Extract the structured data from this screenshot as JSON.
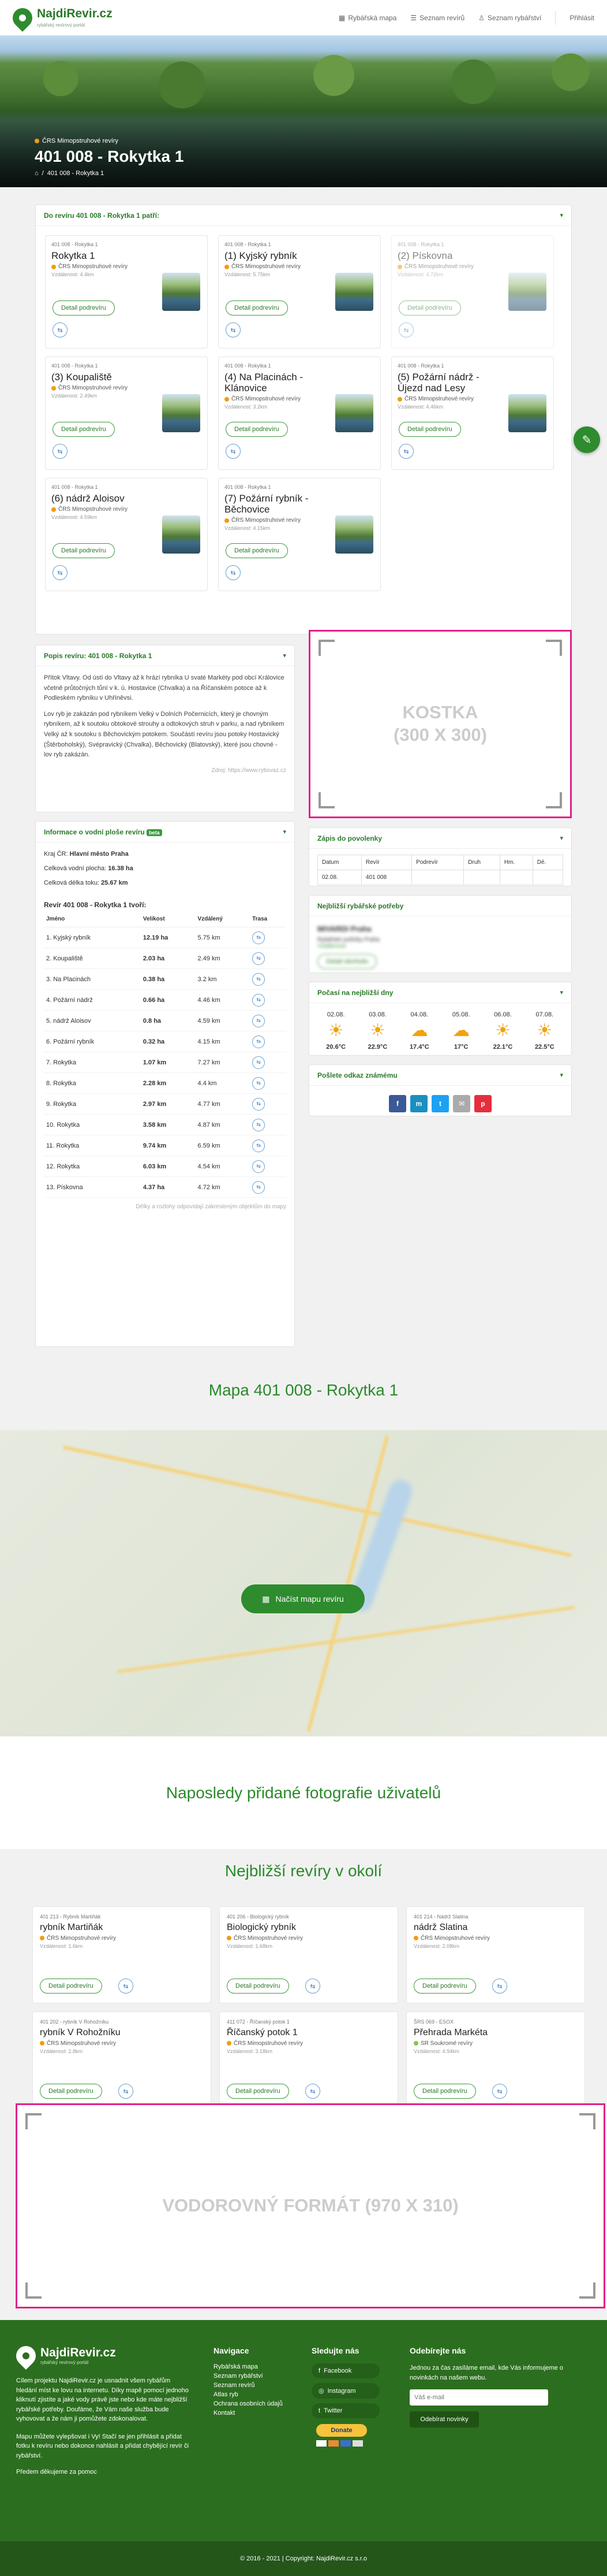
{
  "header": {
    "logo_name": "NajdiRevir.cz",
    "logo_tagline": "rybářský revírový portál",
    "nav": [
      {
        "label": "Rybářská mapa",
        "icon": "map-icon"
      },
      {
        "label": "Seznam revírů",
        "icon": "list-icon"
      },
      {
        "label": "Seznam rybářství",
        "icon": "person-icon"
      },
      {
        "label": "Přihlásit",
        "icon": ""
      }
    ]
  },
  "hero": {
    "label": "ČRS Mimopstruhové revíry",
    "title": "401 008 - Rokytka 1",
    "breadcrumb": "401 008 - Rokytka 1"
  },
  "belongs": {
    "title": "Do revíru 401 008 - Rokytka 1 patří:",
    "detail": "Detail podrevíru",
    "items": [
      {
        "cat": "401 008 - Rokytka 1",
        "name": "Rokytka 1",
        "org": "ČRS Mimopstruhové revíry",
        "dist": "Vzdálenost: 4.4km",
        "faded": false
      },
      {
        "cat": "401 008 - Rokytka 1",
        "name": "(1) Kyjský rybník",
        "org": "ČRS Mimopstruhové revíry",
        "dist": "Vzdálenost: 5.75km",
        "faded": false
      },
      {
        "cat": "401 008 - Rokytka 1",
        "name": "(2) Pískovna",
        "org": "ČRS Mimopstruhové revíry",
        "dist": "Vzdálenost: 4.72km",
        "faded": true
      },
      {
        "cat": "401 008 - Rokytka 1",
        "name": "(3) Koupaliště",
        "org": "ČRS Mimopstruhové revíry",
        "dist": "Vzdálenost: 2.49km",
        "faded": false
      },
      {
        "cat": "401 008 - Rokytka 1",
        "name": "(4) Na Placinách - Klánovice",
        "org": "ČRS Mimopstruhové revíry",
        "dist": "Vzdálenost: 3.2km",
        "faded": false
      },
      {
        "cat": "401 008 - Rokytka 1",
        "name": "(5) Požární nádrž - Újezd nad Lesy",
        "org": "ČRS Mimopstruhové revíry",
        "dist": "Vzdálenost: 4.46km",
        "faded": false
      },
      {
        "cat": "401 008 - Rokytka 1",
        "name": "(6) nádrž Aloisov",
        "org": "ČRS Mimopstruhové revíry",
        "dist": "Vzdálenost: 4.59km",
        "faded": false
      },
      {
        "cat": "401 008 - Rokytka 1",
        "name": "(7) Požární rybník - Běchovice",
        "org": "ČRS Mimopstruhové revíry",
        "dist": "Vzdálenost: 4.15km",
        "faded": false
      }
    ]
  },
  "description": {
    "title": "Popis revíru: 401 008 - Rokytka 1",
    "p1": "Přítok Vltavy. Od ústí do Vltavy až k hrází rybníka U svaté Markéty pod obcí Královice včetně průtočných tůní v k. ú. Hostavice (Chvalka) a na Říčanském potoce až k Podleském rybníku v Uhříněvsi.",
    "p2": "Lov ryb je zakázán pod rybníkem Velký v Dolních Počernicích, který je chovným rybníkem, až k soutoku obtokové strouhy a odtokových struh v parku, a nad rybníkem Velký až k soutoku s Běchovickým potokem. Součástí revíru jsou potoky Hostavický (Štěrbohol­ský), Svépravický (Chvalka), Běchovický (Blatovský), které jsou chovné - lov ryb zakázán.",
    "source": "Zdroj: https://www.rybsvaz.cz"
  },
  "ad_square": {
    "text": "KOSTKA\n(300 X 300)"
  },
  "water_info": {
    "title": "Informace o vodní ploše revíru",
    "badge": "beta",
    "kraj_label": "Kraj ČR:",
    "kraj": "Hlavní město Praha",
    "area_label": "Celková vodní plocha:",
    "area": "16.38 ha",
    "length_label": "Celková délka toku:",
    "length": "25.67 km",
    "consists": "Revír 401 008 - Rokytka 1 tvoří:",
    "columns": [
      "Jméno",
      "Velikost",
      "Vzdálený",
      "Trasa"
    ],
    "rows": [
      [
        "1. Kyjský rybník",
        "12.19 ha",
        "5.75 km"
      ],
      [
        "2. Koupaliště",
        "2.03 ha",
        "2.49 km"
      ],
      [
        "3. Na Placinách",
        "0.38 ha",
        "3.2 km"
      ],
      [
        "4. Požární nádrž",
        "0.66 ha",
        "4.46 km"
      ],
      [
        "5. nádrž Aloisov",
        "0.8 ha",
        "4.59 km"
      ],
      [
        "6. Požární rybník",
        "0.32 ha",
        "4.15 km"
      ],
      [
        "7. Rokytka",
        "1.07 km",
        "7.27 km"
      ],
      [
        "8. Rokytka",
        "2.28 km",
        "4.4 km"
      ],
      [
        "9. Rokytka",
        "2.97 km",
        "4.77 km"
      ],
      [
        "10. Rokytka",
        "3.58 km",
        "4.87 km"
      ],
      [
        "11. Rokytka",
        "9.74 km",
        "6.59 km"
      ],
      [
        "12. Rokytka",
        "6.03 km",
        "4.54 km"
      ],
      [
        "13. Pískovna",
        "4.37 ha",
        "4.72 km"
      ]
    ],
    "note": "Délky a rozlohy odpovídají zakresleným objektům do mapy"
  },
  "catch": {
    "title": "Zápis do povolenky",
    "columns": [
      "Datum",
      "Revír",
      "Podrevír",
      "Druh",
      "Hm.",
      "Dé."
    ],
    "row": [
      "02.08.",
      "401 008",
      "",
      "",
      "",
      ""
    ]
  },
  "shop": {
    "title": "Nejbližší rybářské potřeby",
    "name": "MIVARDI Praha",
    "line1": "Rybářské potřeby Praha",
    "line2": "Vzdálenost",
    "btn": "Detail obchodu"
  },
  "weather": {
    "title": "Počasí na nejbližší dny",
    "days": [
      {
        "d": "02.08.",
        "t": "20.6°C",
        "i": "☀"
      },
      {
        "d": "03.08.",
        "t": "22.9°C",
        "i": "☀"
      },
      {
        "d": "04.08.",
        "t": "17.4°C",
        "i": "☁"
      },
      {
        "d": "05.08.",
        "t": "17°C",
        "i": "☁"
      },
      {
        "d": "06.08.",
        "t": "22.1°C",
        "i": "☀"
      },
      {
        "d": "07.08.",
        "t": "22.5°C",
        "i": "☀"
      }
    ]
  },
  "share": {
    "title": "Pošlete odkaz známému"
  },
  "map_section": {
    "title": "Mapa 401 008 - Rokytka 1",
    "load": "Načíst mapu revíru"
  },
  "photos": {
    "title": "Naposledy přidané fotografie uživatelů"
  },
  "nearest": {
    "title": "Nejbližší revíry v okolí",
    "detail": "Detail podrevíru",
    "items": [
      {
        "cat": "401 213 - Rybník Martiňák",
        "name": "rybník Martiňák",
        "org": "ČRS Mimopstruhové revíry",
        "dist": "Vzdálenost: 1.6km",
        "color": "#f39c12"
      },
      {
        "cat": "401 206 - Biologický rybník",
        "name": "Biologický rybník",
        "org": "ČRS Mimopstruhové revíry",
        "dist": "Vzdálenost: 1.68km",
        "color": "#f39c12"
      },
      {
        "cat": "401 214 - Nádrž Slatina",
        "name": "nádrž Slatina",
        "org": "ČRS Mimopstruhové revíry",
        "dist": "Vzdálenost: 2.08km",
        "color": "#f39c12"
      },
      {
        "cat": "401 202 - rybník V Rohožníku",
        "name": "rybník V Rohožníku",
        "org": "ČRS Mimopstruhové revíry",
        "dist": "Vzdálenost: 2.8km",
        "color": "#f39c12"
      },
      {
        "cat": "411 072 - Říčanský potok 1",
        "name": "Říčanský potok 1",
        "org": "ČRS Mimopstruhové revíry",
        "dist": "Vzdálenost: 3.18km",
        "color": "#f39c12"
      },
      {
        "cat": "ŠRS 069 - ESOX",
        "name": "Přehrada Markéta",
        "org": "SR Soukromé revíry",
        "dist": "Vzdálenost: 4.94km",
        "color": "#8bc34a"
      }
    ]
  },
  "ad_wide": {
    "text": "VODOROVNÝ FORMÁT (970 X 310)"
  },
  "footer": {
    "about1": "Cílem projektu NajdiRevir.cz je usnadnit všem rybářům hledání míst ke lovu na internetu. Díky mapě pomocí jednoho kliknutí zjistíte a jaké vody právě jste nebo kde máte nejbližší rybářské potřeby. Doufáme, že Vám naše služba bude vyhovovat a že nám ji pomůžete zdokonalovat.",
    "about2": "Mapu můžete vylepšovat i Vy! Stačí se jen přihlásit a přidat fotku k revíru nebo dokonce nahlásit a přidat chybějící revír či rybářství.",
    "thanks": "Předem děkujeme za pomoc",
    "nav_title": "Navigace",
    "nav_items": [
      "Rybářská mapa",
      "Seznam rybářství",
      "Seznam revírů",
      "Atlas ryb",
      "Ochrana osobních údajů",
      "Kontakt"
    ],
    "follow_title": "Sledujte nás",
    "follow": [
      "Facebook",
      "Instagram",
      "Twitter"
    ],
    "donate": "Donate",
    "sub_title": "Odebírejte nás",
    "sub_text": "Jednou za čas zasíláme email, kde Vás informujeme o novinkách na našem webu.",
    "sub_placeholder": "Váš e-mail",
    "sub_btn": "Odebírat novinky",
    "copyright": "© 2016 - 2021 | Copyright: NajdiRevir.cz s.r.o"
  }
}
